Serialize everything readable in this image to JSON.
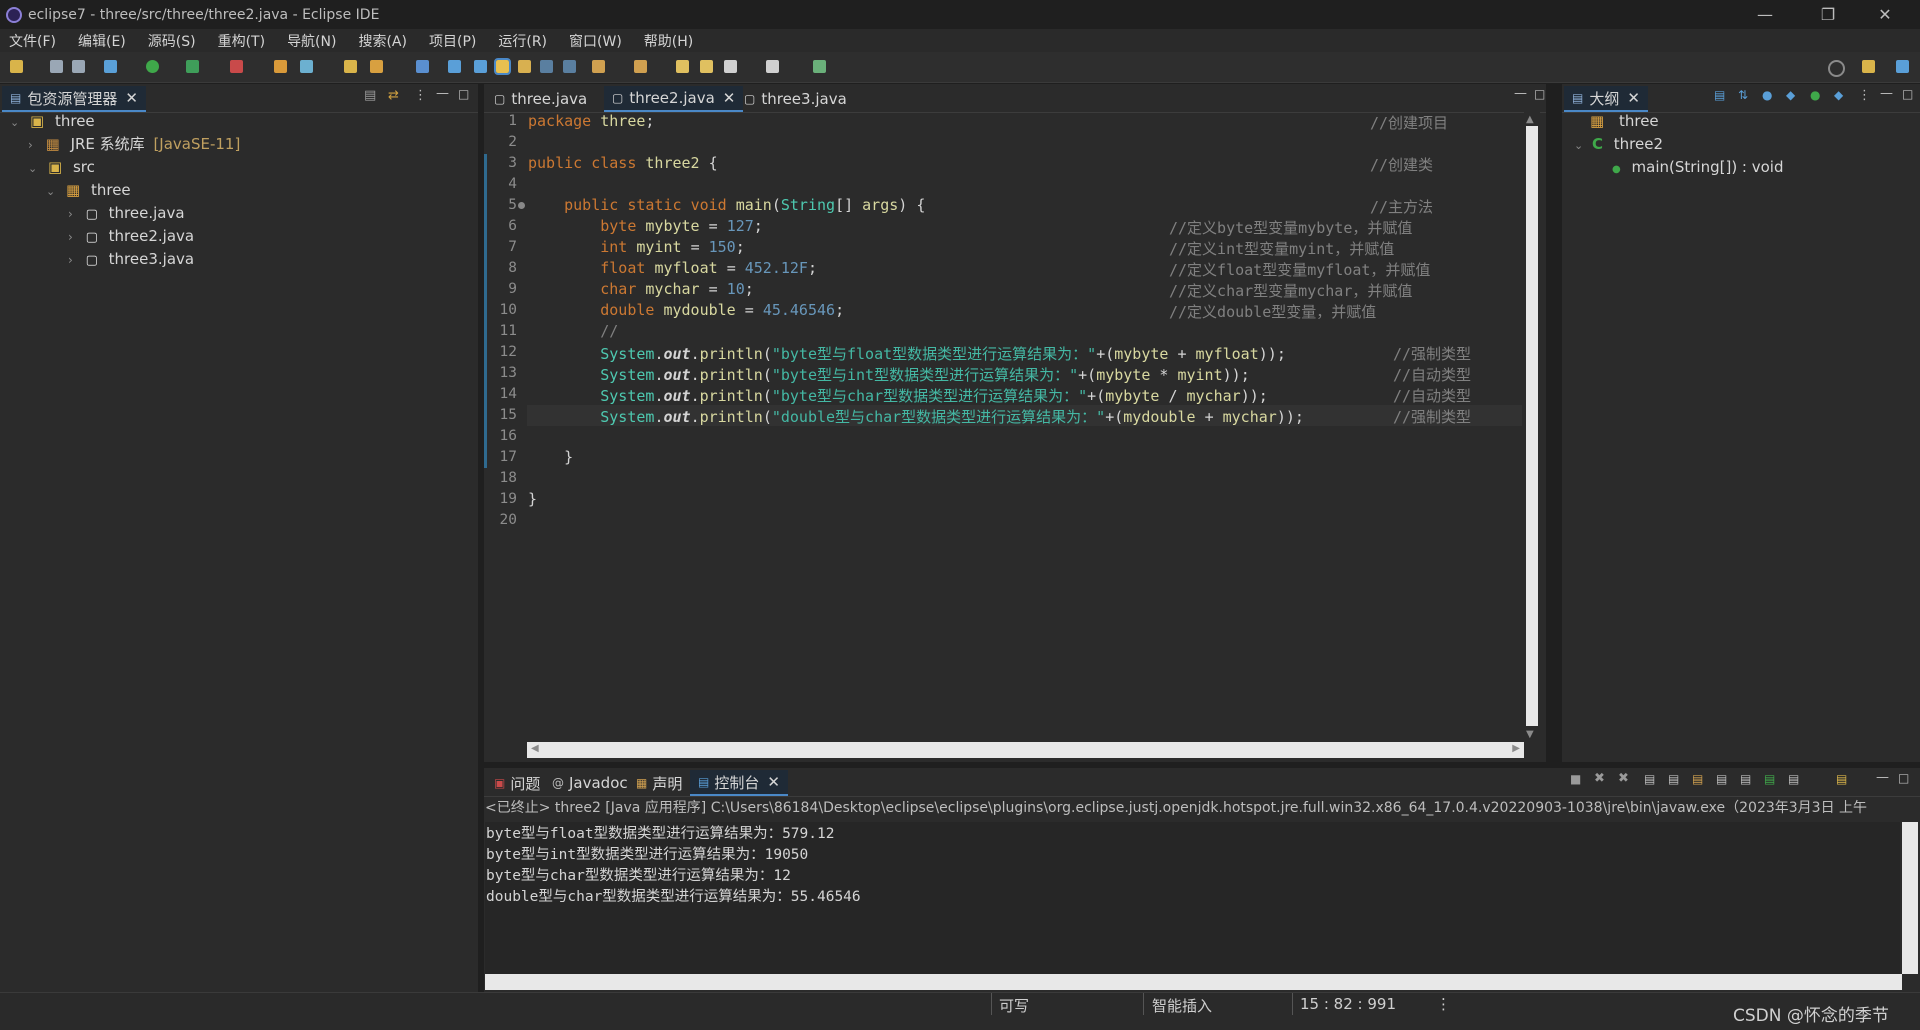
{
  "window": {
    "title": "eclipse7 - three/src/three/three2.java - Eclipse IDE"
  },
  "menu": [
    "文件(F)",
    "编辑(E)",
    "源码(S)",
    "重构(T)",
    "导航(N)",
    "搜索(A)",
    "项目(P)",
    "运行(R)",
    "窗口(W)",
    "帮助(H)"
  ],
  "package_explorer": {
    "title": "包资源管理器",
    "items": [
      {
        "label": "three",
        "icon": "project-icon"
      },
      {
        "label": "JRE 系统库",
        "suffix": "[JavaSE-11]",
        "icon": "library-icon"
      },
      {
        "label": "src",
        "icon": "source-folder-icon"
      },
      {
        "label": "three",
        "icon": "package-icon"
      },
      {
        "label": "three.java",
        "icon": "java-file-icon"
      },
      {
        "label": "three2.java",
        "icon": "java-file-icon"
      },
      {
        "label": "three3.java",
        "icon": "java-file-icon"
      }
    ]
  },
  "editor": {
    "tabs": [
      "three.java",
      "three2.java",
      "three3.java"
    ],
    "active_tab": "three2.java",
    "line_numbers": [
      "1",
      "2",
      "3",
      "4",
      "5",
      "6",
      "7",
      "8",
      "9",
      "10",
      "11",
      "12",
      "13",
      "14",
      "15",
      "16",
      "17",
      "18",
      "19",
      "20"
    ],
    "lines": [
      {
        "code": "package three;",
        "comment": "//创建项目"
      },
      {
        "code": "",
        "comment": ""
      },
      {
        "code": "public class three2 {",
        "comment": "//创建类"
      },
      {
        "code": "",
        "comment": ""
      },
      {
        "code": "    public static void main(String[] args) {",
        "comment": "//主方法"
      },
      {
        "code": "        byte mybyte = 127;",
        "comment": "//定义byte型变量mybyte，并赋值"
      },
      {
        "code": "        int myint = 150;",
        "comment": "//定义int型变量myint，并赋值"
      },
      {
        "code": "        float myfloat = 452.12F;",
        "comment": "//定义float型变量myfloat，并赋值"
      },
      {
        "code": "        char mychar = 10;",
        "comment": "//定义char型变量mychar，并赋值"
      },
      {
        "code": "        double mydouble = 45.46546;",
        "comment": "//定义double型变量，并赋值"
      },
      {
        "code": "        //",
        "comment": ""
      },
      {
        "code": "        System.out.println(\"byte型与float型数据类型进行运算结果为：\"+(mybyte + myfloat));",
        "comment": "//强制类型"
      },
      {
        "code": "        System.out.println(\"byte型与int型数据类型进行运算结果为：\"+(mybyte * myint));",
        "comment": "//自动类型"
      },
      {
        "code": "        System.out.println(\"byte型与char型数据类型进行运算结果为：\"+(mybyte / mychar));",
        "comment": "//自动类型"
      },
      {
        "code": "        System.out.println(\"double型与char型数据类型进行运算结果为：\"+(mydouble + mychar));",
        "comment": "//强制类型"
      },
      {
        "code": "",
        "comment": ""
      },
      {
        "code": "    }",
        "comment": ""
      },
      {
        "code": "",
        "comment": ""
      },
      {
        "code": "}",
        "comment": ""
      },
      {
        "code": "",
        "comment": ""
      }
    ]
  },
  "outline": {
    "title": "大纲",
    "items": [
      {
        "label": "three",
        "icon": "package-icon"
      },
      {
        "label": "three2",
        "icon": "class-icon"
      },
      {
        "label": "main(String[]) : void",
        "icon": "method-icon"
      }
    ]
  },
  "bottom_panel": {
    "tabs": [
      "问题",
      "Javadoc",
      "声明",
      "控制台"
    ],
    "active_tab": "控制台",
    "header": "<已终止> three2 [Java 应用程序] C:\\Users\\86184\\Desktop\\eclipse\\eclipse\\plugins\\org.eclipse.justj.openjdk.hotspot.jre.full.win32.x86_64_17.0.4.v20220903-1038\\jre\\bin\\javaw.exe（2023年3月3日 上午",
    "output": [
      "byte型与float型数据类型进行运算结果为：579.12",
      "byte型与int型数据类型进行运算结果为：19050",
      "byte型与char型数据类型进行运算结果为：12",
      "double型与char型数据类型进行运算结果为：55.46546"
    ]
  },
  "status_bar": {
    "writable": "可写",
    "insert_mode": "智能插入",
    "position": "15 : 82 : 991",
    "watermark": "CSDN @怀念的季节"
  },
  "colors": {
    "accent": "#4a88c7",
    "background": "#2b2b2b"
  }
}
